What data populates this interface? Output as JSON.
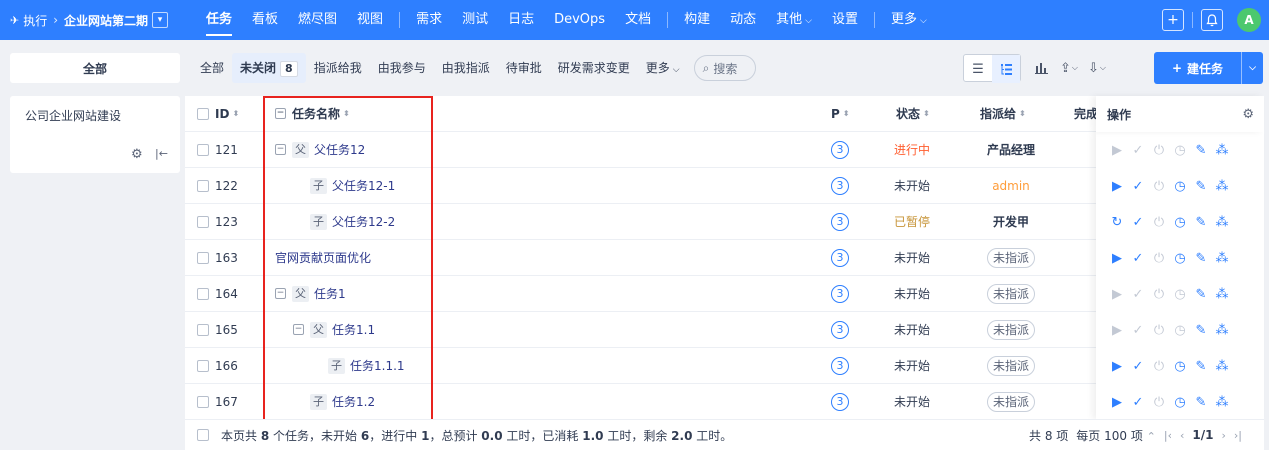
{
  "topbar": {
    "breadcrumb_root": "执行",
    "breadcrumb_project": "企业网站第二期",
    "nav_items": [
      "任务",
      "看板",
      "燃尽图",
      "视图"
    ],
    "nav_items2": [
      "需求",
      "测试",
      "日志",
      "DevOps",
      "文档"
    ],
    "nav_items3": [
      "构建",
      "动态"
    ],
    "nav_more_other": "其他",
    "nav_settings": "设置",
    "nav_more": "更多",
    "avatar_letter": "A"
  },
  "filter": {
    "all_label": "全部",
    "tabs": [
      "全部",
      "未关闭",
      "指派给我",
      "由我参与",
      "由我指派",
      "待审批",
      "研发需求变更",
      "更多"
    ],
    "unclosed_count": "8",
    "search_label": "搜索",
    "create_label": "建任务"
  },
  "sidebar": {
    "project_name": "公司企业网站建设"
  },
  "table": {
    "headers": {
      "id": "ID",
      "name": "任务名称",
      "p": "P",
      "status": "状态",
      "assign": "指派给",
      "done": "完成",
      "ops": "操作"
    },
    "rows": [
      {
        "id": "121",
        "tag": "父",
        "name": "父任务12",
        "p": "3",
        "status": "进行中",
        "assign": "产品经理"
      },
      {
        "id": "122",
        "tag": "子",
        "name": "父任务12-1",
        "p": "3",
        "status": "未开始",
        "assign": "admin"
      },
      {
        "id": "123",
        "tag": "子",
        "name": "父任务12-2",
        "p": "3",
        "status": "已暂停",
        "assign": "开发甲"
      },
      {
        "id": "163",
        "tag": "",
        "name": "官网贡献页面优化",
        "p": "3",
        "status": "未开始",
        "assign": "未指派"
      },
      {
        "id": "164",
        "tag": "父",
        "name": "任务1",
        "p": "3",
        "status": "未开始",
        "assign": "未指派"
      },
      {
        "id": "165",
        "tag": "父",
        "name": "任务1.1",
        "p": "3",
        "status": "未开始",
        "assign": "未指派"
      },
      {
        "id": "166",
        "tag": "子",
        "name": "任务1.1.1",
        "p": "3",
        "status": "未开始",
        "assign": "未指派"
      },
      {
        "id": "167",
        "tag": "子",
        "name": "任务1.2",
        "p": "3",
        "status": "未开始",
        "assign": "未指派"
      }
    ]
  },
  "footer": {
    "summary_prefix": "本页共",
    "total_tasks": "8",
    "summary_mid1": "个任务，未开始",
    "not_started": "6",
    "summary_mid2": "，进行中",
    "in_progress": "1",
    "summary_mid3": "，总预计",
    "estimate": "0.0",
    "summary_mid4": "工时，已消耗",
    "consumed": "1.0",
    "summary_mid5": "工时，剩余",
    "left": "2.0",
    "summary_end": "工时。",
    "total_items": "共 8 项",
    "per_page": "每页 100 项",
    "page": "1/1"
  }
}
